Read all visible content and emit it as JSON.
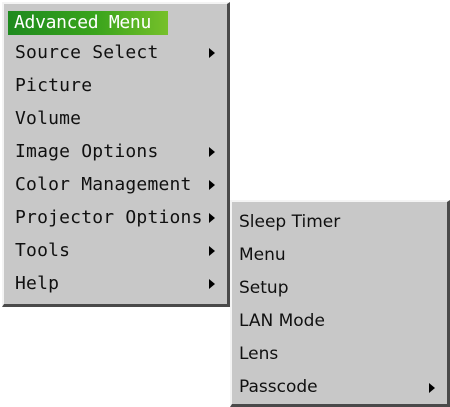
{
  "main_menu": {
    "title": "Advanced Menu",
    "items": [
      {
        "label": "Source Select",
        "submenu": true
      },
      {
        "label": "Picture",
        "submenu": false
      },
      {
        "label": "Volume",
        "submenu": false
      },
      {
        "label": "Image Options",
        "submenu": true
      },
      {
        "label": "Color Management",
        "submenu": true
      },
      {
        "label": "Projector Options",
        "submenu": true
      },
      {
        "label": "Tools",
        "submenu": true
      },
      {
        "label": "Help",
        "submenu": true
      }
    ]
  },
  "submenu": {
    "parent": "Projector Options",
    "items": [
      {
        "label": "Sleep Timer",
        "submenu": false
      },
      {
        "label": "Menu",
        "submenu": false
      },
      {
        "label": "Setup",
        "submenu": false
      },
      {
        "label": "LAN Mode",
        "submenu": false
      },
      {
        "label": "Lens",
        "submenu": false
      },
      {
        "label": "Passcode",
        "submenu": true
      }
    ]
  },
  "colors": {
    "menu_background": "#c8c8c8",
    "title_gradient_start": "#1e8a1e",
    "title_gradient_end": "#76c02a",
    "title_text": "#ffffff",
    "item_text": "#101010"
  }
}
